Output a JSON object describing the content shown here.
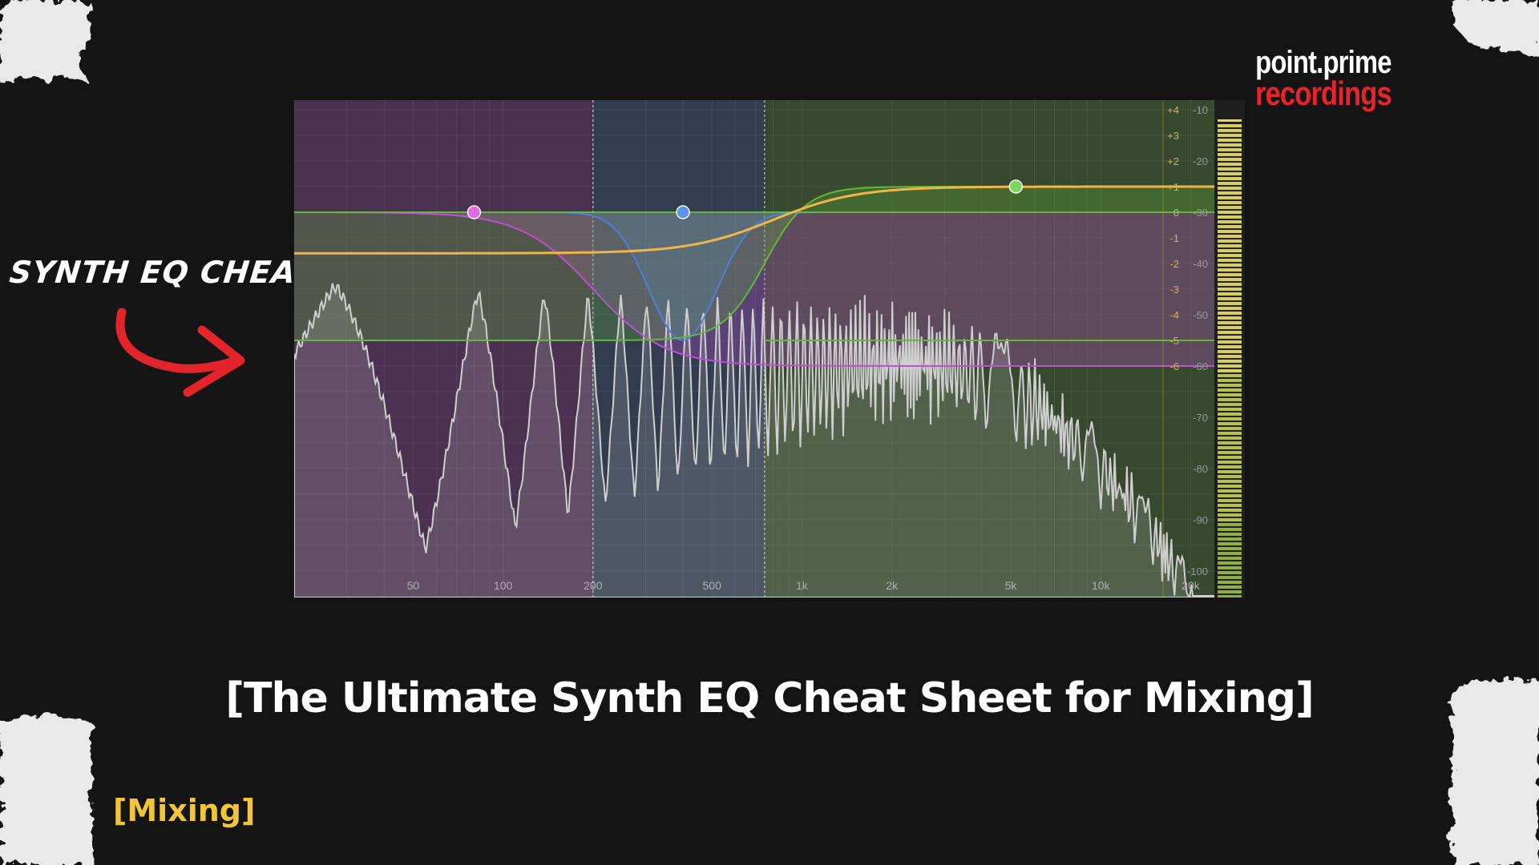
{
  "logo": {
    "line1": "point.prime",
    "line2": "recordings"
  },
  "callout": {
    "text": "SYNTH EQ CHEAT"
  },
  "title": "[The Ultimate Synth EQ Cheat Sheet for Mixing]",
  "category_tag": "[Mixing]",
  "eq": {
    "freq_labels": [
      {
        "hz": 50,
        "label": "50"
      },
      {
        "hz": 100,
        "label": "100"
      },
      {
        "hz": 200,
        "label": "200"
      },
      {
        "hz": 500,
        "label": "500"
      },
      {
        "hz": 1000,
        "label": "1k"
      },
      {
        "hz": 2000,
        "label": "2k"
      },
      {
        "hz": 5000,
        "label": "5k"
      },
      {
        "hz": 10000,
        "label": "10k"
      },
      {
        "hz": 20000,
        "label": "20k"
      }
    ],
    "gain_labels": [
      "+4",
      "+3",
      "+2",
      "+1",
      "0",
      "-1",
      "-2",
      "-3",
      "-4",
      "-5",
      "-6"
    ],
    "level_labels": [
      "-10",
      "-20",
      "-30",
      "-40",
      "-50",
      "-60",
      "-70",
      "-80",
      "-90",
      "-100"
    ],
    "bands": [
      {
        "name": "low",
        "color": "#c14fd6",
        "from_hz": 20,
        "to_hz": 200
      },
      {
        "name": "mid",
        "color": "#4f7fd6",
        "from_hz": 200,
        "to_hz": 750
      },
      {
        "name": "high",
        "color": "#62b83a",
        "from_hz": 750,
        "to_hz": 24000
      }
    ],
    "nodes": [
      {
        "name": "low-shelf-node",
        "hz": 80,
        "gain_db": 0,
        "color": "#e36be6"
      },
      {
        "name": "mid-bell-node",
        "hz": 400,
        "gain_db": 0,
        "color": "#5e93e6"
      },
      {
        "name": "high-shelf-node",
        "hz": 5200,
        "gain_db": 1,
        "color": "#7fd65a"
      }
    ],
    "colors": {
      "curve": "#f2b54a",
      "spectrum": "#cfcfcf",
      "meter": "#c9c23a"
    }
  }
}
